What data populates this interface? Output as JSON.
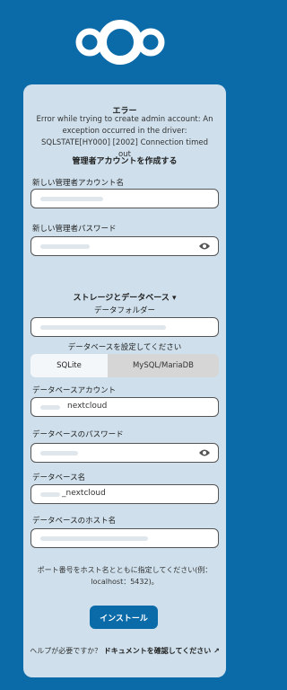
{
  "error": {
    "title": "エラー",
    "message": "Error while trying to create admin account: An exception occurred in the driver: SQLSTATE[HY000] [2002] Connection timed out"
  },
  "admin": {
    "section_title": "管理者アカウントを作成する",
    "username_label": "新しい管理者アカウント名",
    "password_label": "新しい管理者パスワード"
  },
  "storage": {
    "section_title": "ストレージとデータベース ▾",
    "data_folder_label": "データフォルダー",
    "db_config_label": "データベースを設定してください",
    "db_options": [
      "SQLite",
      "MySQL/MariaDB"
    ]
  },
  "db": {
    "account_label": "データベースアカウント",
    "account_value": "nextcloud",
    "password_label": "データベースのパスワード",
    "name_label": "データベース名",
    "name_value": "_nextcloud",
    "host_label": "データベースのホスト名"
  },
  "hint": "ポート番号をホスト名とともに指定してください(例：localhost：5432)。",
  "install_button": "インストール",
  "help": {
    "question": "ヘルプが必要ですか？",
    "link": "ドキュメントを確認してください ↗"
  },
  "colors": {
    "brand": "#0b6aa8",
    "card": "#cfe0ec"
  }
}
